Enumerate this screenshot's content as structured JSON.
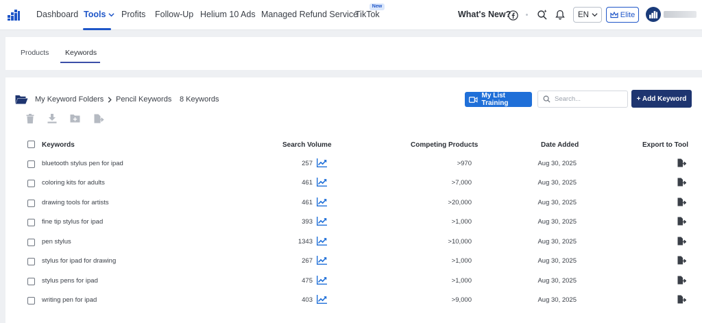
{
  "nav": {
    "items": [
      {
        "label": "Dashboard"
      },
      {
        "label": "Tools"
      },
      {
        "label": "Profits"
      },
      {
        "label": "Follow-Up"
      },
      {
        "label": "Helium 10 Ads"
      },
      {
        "label": "Managed Refund Service"
      },
      {
        "label": "TikTok"
      }
    ],
    "new_badge": "New",
    "whats_new": "What's New?",
    "language": "EN",
    "plan": "Elite",
    "brand_color": "#1f56c8"
  },
  "subtabs": [
    {
      "label": "Products"
    },
    {
      "label": "Keywords"
    }
  ],
  "breadcrumb": {
    "root": "My Keyword Folders",
    "folder": "Pencil Keywords",
    "count": "8 Keywords"
  },
  "actions": {
    "training_label": "My List Training",
    "search_placeholder": "Search...",
    "add_label": "+ Add Keyword"
  },
  "table": {
    "columns": {
      "keywords": "Keywords",
      "search_volume": "Search Volume",
      "competing": "Competing Products",
      "date_added": "Date Added",
      "export": "Export to Tool"
    },
    "rows": [
      {
        "keyword": "bluetooth stylus pen for ipad",
        "volume": "257",
        "competing": ">970",
        "date": "Aug 30, 2025"
      },
      {
        "keyword": "coloring kits for adults",
        "volume": "461",
        "competing": ">7,000",
        "date": "Aug 30, 2025"
      },
      {
        "keyword": "drawing tools for artists",
        "volume": "461",
        "competing": ">20,000",
        "date": "Aug 30, 2025"
      },
      {
        "keyword": "fine tip stylus for ipad",
        "volume": "393",
        "competing": ">1,000",
        "date": "Aug 30, 2025"
      },
      {
        "keyword": "pen stylus",
        "volume": "1343",
        "competing": ">10,000",
        "date": "Aug 30, 2025"
      },
      {
        "keyword": "stylus for ipad for drawing",
        "volume": "267",
        "competing": ">1,000",
        "date": "Aug 30, 2025"
      },
      {
        "keyword": "stylus pens for ipad",
        "volume": "475",
        "competing": ">1,000",
        "date": "Aug 30, 2025"
      },
      {
        "keyword": "writing pen for ipad",
        "volume": "403",
        "competing": ">9,000",
        "date": "Aug 30, 2025"
      }
    ]
  }
}
